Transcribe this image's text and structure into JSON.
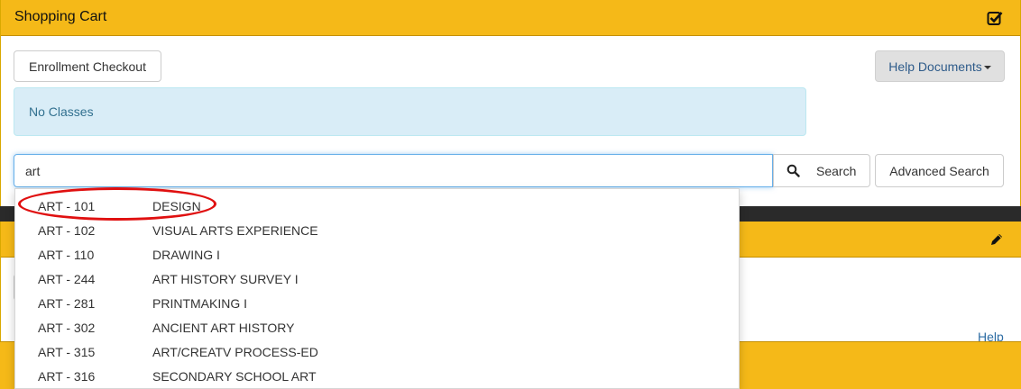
{
  "cart_panel": {
    "title": "Shopping Cart",
    "icon": "check-square-icon"
  },
  "buttons": {
    "enrollment_checkout": "Enrollment Checkout",
    "help_documents": "Help Documents",
    "search": "Search",
    "advanced_search": "Advanced Search"
  },
  "alert": {
    "text": "No Classes"
  },
  "search": {
    "value": "art",
    "icon": "search-icon"
  },
  "second_panel": {
    "icon": "pencil-icon",
    "help_link": "Help"
  },
  "suggestions": [
    {
      "code": "ART - 101",
      "name": "DESIGN",
      "highlighted": true
    },
    {
      "code": "ART - 102",
      "name": "VISUAL ARTS EXPERIENCE"
    },
    {
      "code": "ART - 110",
      "name": "DRAWING I"
    },
    {
      "code": "ART - 244",
      "name": "ART HISTORY SURVEY I"
    },
    {
      "code": "ART - 281",
      "name": "PRINTMAKING I"
    },
    {
      "code": "ART - 302",
      "name": "ANCIENT ART HISTORY"
    },
    {
      "code": "ART - 315",
      "name": "ART/CREATV PROCESS-ED"
    },
    {
      "code": "ART - 316",
      "name": "SECONDARY SCHOOL ART"
    }
  ],
  "colors": {
    "header_gold": "#f5b918",
    "alert_bg": "#d9edf7",
    "alert_text": "#31708f",
    "annotation_red": "#e01010"
  }
}
